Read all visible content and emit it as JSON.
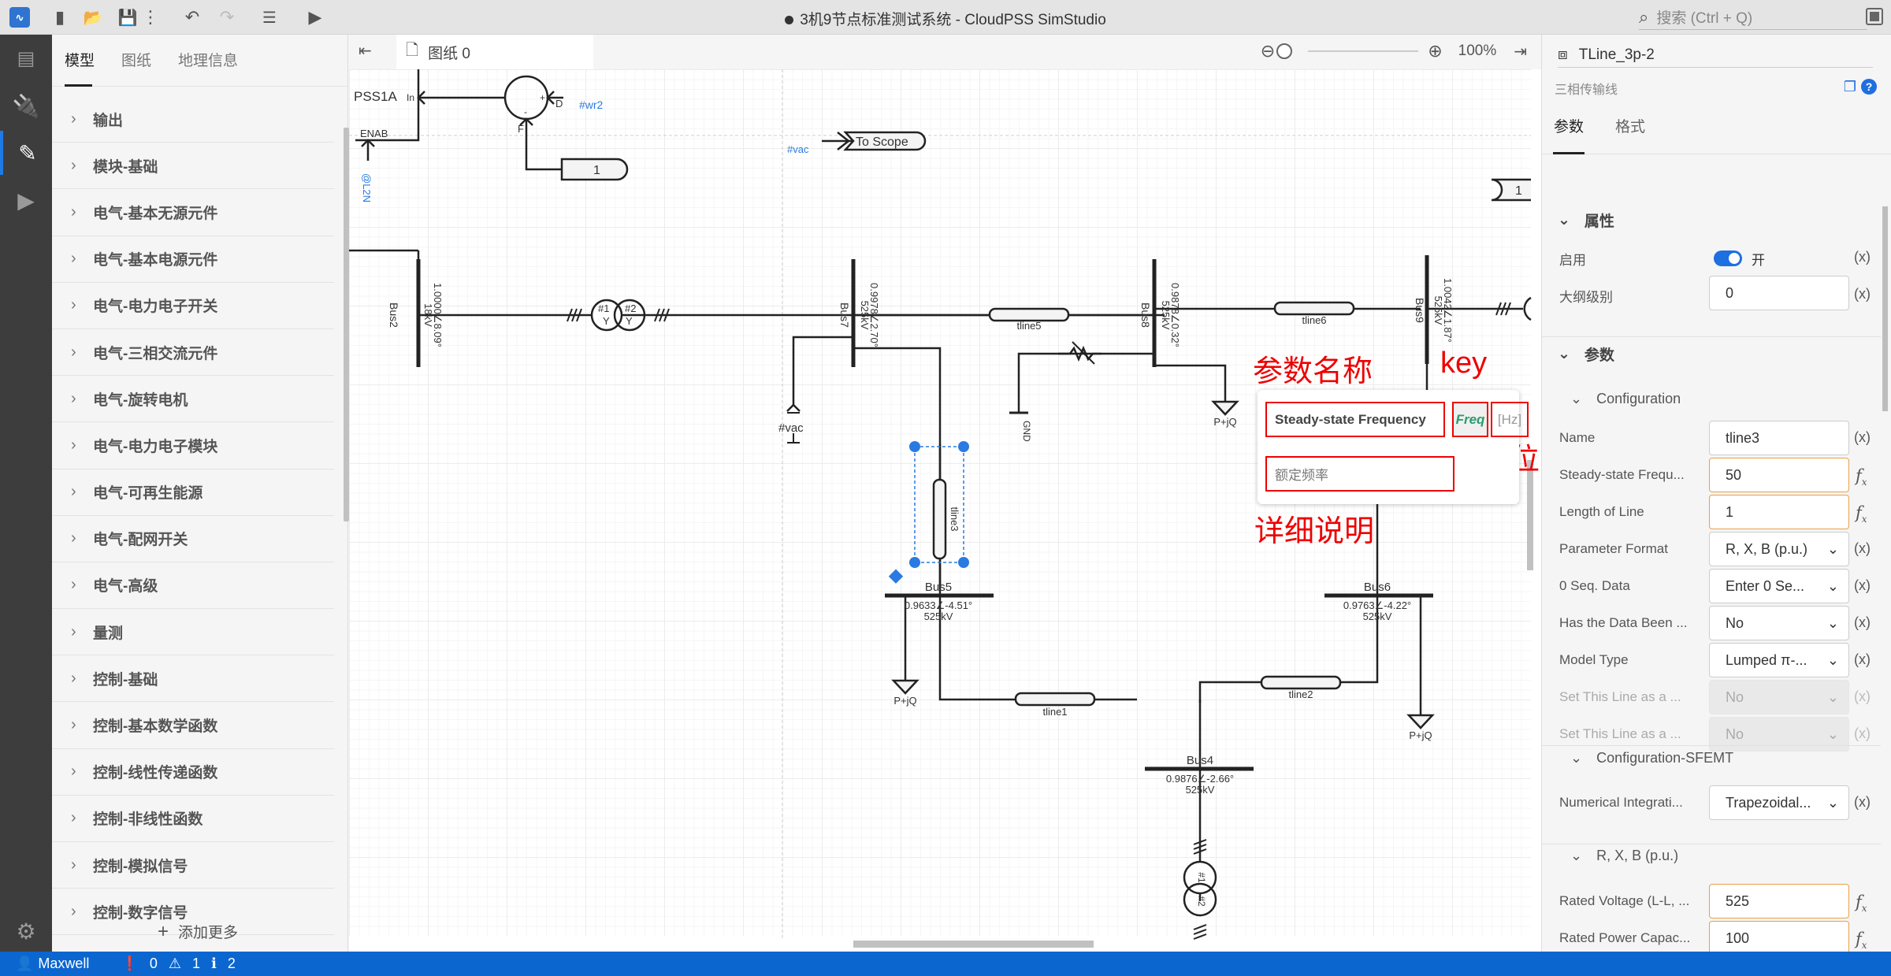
{
  "window": {
    "title": "3机9节点标准测试系统 - CloudPSS SimStudio",
    "unsaved": true
  },
  "toolbar": {
    "icons": [
      "app-logo",
      "new-file",
      "open-folder",
      "save",
      "more",
      "undo",
      "redo",
      "edit-list",
      "run"
    ],
    "search_placeholder": "搜索 (Ctrl + Q)"
  },
  "activity_bar": {
    "items": [
      "overview",
      "plugin",
      "model-edit",
      "run"
    ],
    "active": "model-edit",
    "bottom": "settings"
  },
  "left_panel": {
    "tabs": [
      "模型",
      "图纸",
      "地理信息"
    ],
    "active_tab": "模型",
    "categories": [
      "输出",
      "模块-基础",
      "电气-基本无源元件",
      "电气-基本电源元件",
      "电气-电力电子开关",
      "电气-三相交流元件",
      "电气-旋转电机",
      "电气-电力电子模块",
      "电气-可再生能源",
      "电气-配网开关",
      "电气-高级",
      "量测",
      "控制-基础",
      "控制-基本数学函数",
      "控制-线性传递函数",
      "控制-非线性函数",
      "控制-模拟信号",
      "控制-数字信号"
    ],
    "add_more": "添加更多"
  },
  "canvas": {
    "doc_tab": "图纸 0",
    "zoom_level": "100%",
    "diagram": {
      "pss_block": "PSS1A",
      "pss_in": "In",
      "pss_enab": "ENAB",
      "enab_signal": "@L2N",
      "sum_plus": "+",
      "sum_minus": "-",
      "sum_d": "D",
      "sum_f": "F",
      "wr_signal": "#wr2",
      "const_value": "1",
      "const_value_right": "1",
      "vac_signal": "#vac",
      "scope_label": "To Scope",
      "vac_meter": "#vac",
      "gnd": "GND",
      "buses": [
        {
          "name": "Bus2",
          "v": "1.0000∠8.09°",
          "kv": "18kV"
        },
        {
          "name": "Bus7",
          "v": "0.9978∠2.70°",
          "kv": "525kV"
        },
        {
          "name": "Bus8",
          "v": "0.9878∠0.32°",
          "kv": "525kV"
        },
        {
          "name": "Bus9",
          "v": "1.0042∠1.87°",
          "kv": "525kV"
        },
        {
          "name": "Bus5",
          "v": "0.9633∠-4.51°",
          "kv": "525kV"
        },
        {
          "name": "Bus6",
          "v": "0.9763∠-4.22°",
          "kv": "525kV"
        },
        {
          "name": "Bus4",
          "v": "0.9876∠-2.66°",
          "kv": "525kV"
        }
      ],
      "lines": [
        "tline5",
        "tline6",
        "tline3",
        "tline1",
        "tline2"
      ],
      "transformer": {
        "w1": "#1",
        "w2": "#2",
        "conn": "Y"
      },
      "load_label": "P+jQ"
    },
    "tooltip": {
      "name": "Steady-state Frequency",
      "key": "Freq",
      "unit": "[Hz]",
      "description": "额定频率"
    },
    "annotations": {
      "name": "参数名称",
      "key": "key",
      "unit": "单位",
      "desc": "详细说明"
    }
  },
  "right_panel": {
    "component_name": "TLine_3p-2",
    "component_type": "三相传输线",
    "tabs": [
      "参数",
      "格式"
    ],
    "active_tab": "参数",
    "sections": {
      "attributes": "属性",
      "params": "参数",
      "config": "Configuration",
      "config_sfemt": "Configuration-SFEMT",
      "rxb": "R, X, B (p.u.)"
    },
    "enabled": {
      "label": "启用",
      "state": "开",
      "on": true
    },
    "outline_level": {
      "label": "大纲级别",
      "value": "0"
    },
    "config_fields": [
      {
        "label": "Name",
        "value": "tline3",
        "type": "text",
        "action": "(x)"
      },
      {
        "label": "Steady-state Frequ...",
        "value": "50",
        "type": "fx",
        "action": "fx"
      },
      {
        "label": "Length of Line",
        "value": "1",
        "type": "fx",
        "action": "fx"
      },
      {
        "label": "Parameter Format",
        "value": "R, X, B (p.u.)",
        "type": "select",
        "action": "(x)"
      },
      {
        "label": "0 Seq. Data",
        "value": "Enter 0 Se...",
        "type": "select",
        "action": "(x)"
      },
      {
        "label": "Has the Data Been ...",
        "value": "No",
        "type": "select",
        "action": "(x)"
      },
      {
        "label": "Model Type",
        "value": "Lumped π-...",
        "type": "select",
        "action": "(x)"
      },
      {
        "label": "Set This Line as a ...",
        "value": "No",
        "type": "select-disabled",
        "action": "(x)"
      },
      {
        "label": "Set This Line as a ...",
        "value": "No",
        "type": "select-disabled",
        "action": "(x)"
      }
    ],
    "sfemt_fields": [
      {
        "label": "Numerical Integrati...",
        "value": "Trapezoidal...",
        "type": "select",
        "action": "(x)"
      }
    ],
    "rxb_fields": [
      {
        "label": "Rated Voltage (L-L, ...",
        "value": "525",
        "type": "fx",
        "action": "fx"
      },
      {
        "label": "Rated Power Capac...",
        "value": "100",
        "type": "fx",
        "action": "fx"
      }
    ]
  },
  "status_bar": {
    "user": "Maxwell",
    "errors": "0",
    "warnings": "1",
    "infos": "2"
  }
}
